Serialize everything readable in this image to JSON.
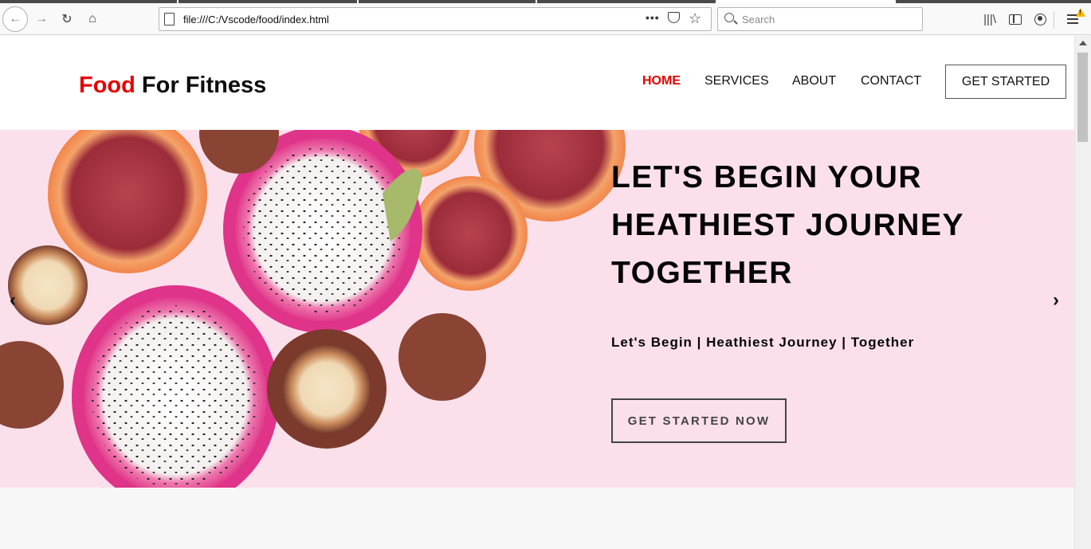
{
  "browser": {
    "url": "file:///C:/Vscode/food/index.html",
    "search_placeholder": "Search",
    "icons": [
      "back-icon",
      "forward-icon",
      "reload-icon",
      "home-icon",
      "page-icon",
      "more-icon",
      "pocket-icon",
      "bookmark-star-icon",
      "search-icon",
      "library-icon",
      "sidebar-icon",
      "account-icon",
      "menu-icon",
      "warning-icon"
    ],
    "nav_glyphs": {
      "back": "←",
      "forward": "→",
      "reload": "↻",
      "home": "⌂",
      "more": "•••",
      "star": "☆",
      "library": "|||\\"
    }
  },
  "site": {
    "logo_accent": "Food",
    "logo_rest": " For Fitness",
    "nav": {
      "home": "HOME",
      "services": "SERVICES",
      "about": "ABOUT",
      "contact": "CONTACT"
    },
    "header_button": "GET STARTED",
    "accent_color": "#e60000"
  },
  "hero": {
    "title_line1": "LET'S BEGIN YOUR",
    "title_line2": "HEATHIEST JOURNEY",
    "title_line3": "TOGETHER",
    "subtitle": "Let's Begin | Heathiest Journey | Together",
    "cta": "GET STARTED NOW",
    "prev_arrow": "‹",
    "next_arrow": "›",
    "background_color": "#fbe0ec"
  }
}
